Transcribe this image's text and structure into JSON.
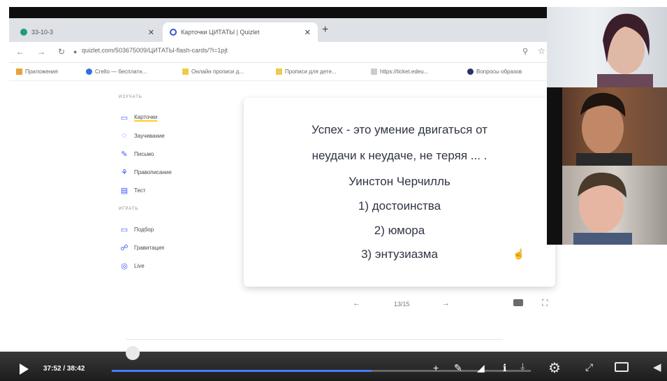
{
  "browser": {
    "tabs": [
      {
        "label": "33-10-3",
        "active": false
      },
      {
        "label": "Карточки ЦИТАТЫ | Quizlet",
        "active": true
      }
    ],
    "url": "quizlet.com/503675009/ЦИТАТЫ-flash-cards/?i=1pjt",
    "bookmarks": [
      "Приложения",
      "Crello — бесплатн...",
      "Онлайн прописи д...",
      "Прописи для дете...",
      "https://ticket.edeu...",
      "Вопросы образов"
    ]
  },
  "sidebar": {
    "study_heading": "ИЗУЧАТЬ",
    "study_items": [
      "Карточки",
      "Заучивание",
      "Письмо",
      "Правописание",
      "Тест"
    ],
    "play_heading": "ИГРАТЬ",
    "play_items": [
      "Подбор",
      "Гравитация",
      "Live"
    ]
  },
  "card": {
    "lines": [
      "Успех - это умение двигаться от",
      "неудачи к неудаче, не теряя ... .",
      "Уинстон Черчилль",
      "1) достоинства",
      "2) юмора",
      "3) энтузиазма"
    ]
  },
  "pager": {
    "prev": "←",
    "position": "13/15",
    "next": "→"
  },
  "video": {
    "time": "37:52 / 38:42",
    "progress": 0.62
  },
  "icons": {
    "accent": "#4255ff",
    "underline": "#ffcd1f"
  }
}
